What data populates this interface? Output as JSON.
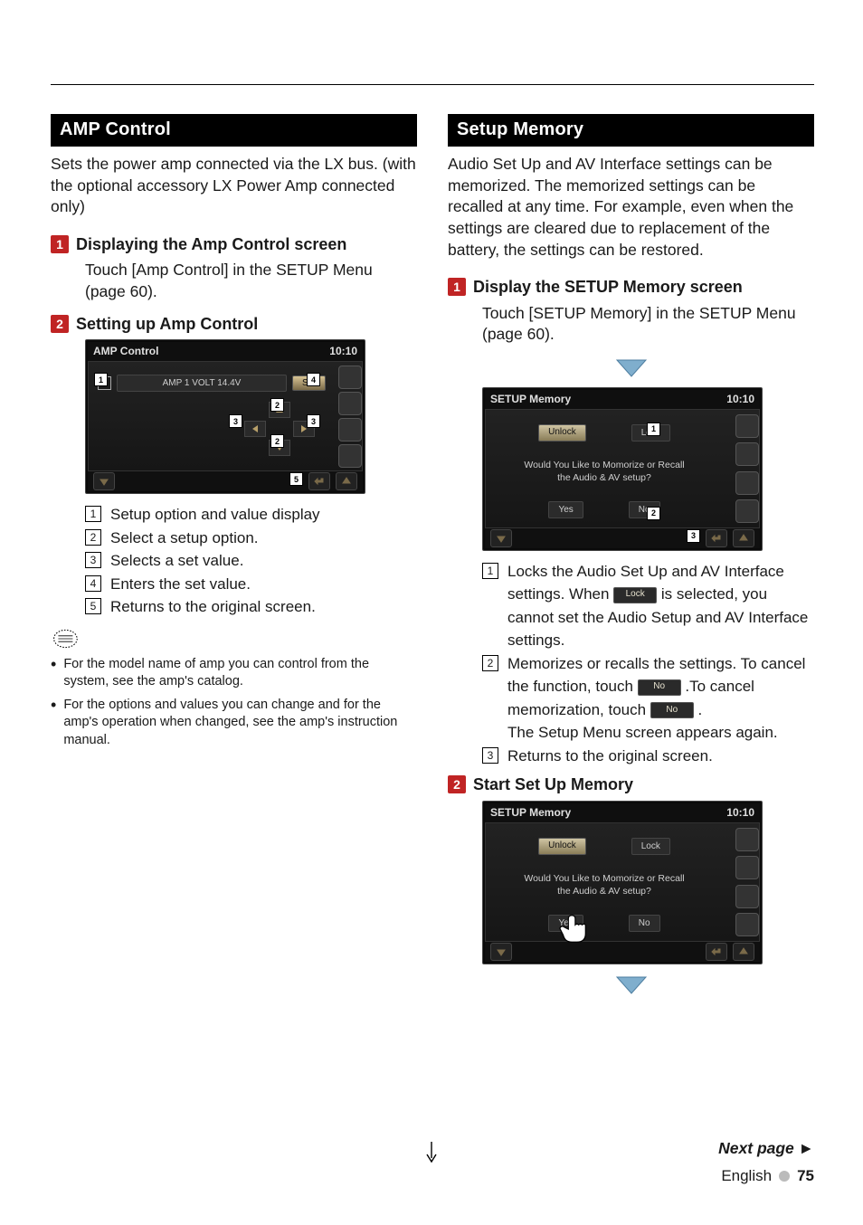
{
  "left": {
    "heading": "AMP Control",
    "lead": "Sets the power amp connected via the LX bus. (with the optional accessory LX Power Amp connected only)",
    "step1_title": "Displaying the Amp Control screen",
    "step1_body": "Touch [Amp Control] in the SETUP Menu (page 60).",
    "step2_title": "Setting up Amp Control",
    "shot": {
      "title": "AMP Control",
      "clock": "10:10",
      "value": "AMP 1 VOLT 14.4V",
      "set": "Set"
    },
    "legend": {
      "i1": "Setup option and value display",
      "i2": "Select a setup option.",
      "i3": "Selects a set value.",
      "i4": "Enters the set value.",
      "i5": "Returns to the original screen."
    },
    "note1": "For the model name of amp you can control from the system, see the amp's catalog.",
    "note2": "For the options and values you can change and for the amp's operation when changed, see the amp's instruction manual."
  },
  "right": {
    "heading": "Setup Memory",
    "lead": "Audio Set Up and AV Interface settings can be memorized. The memorized settings can be recalled at any time. For example, even when the settings are cleared due to replacement of the battery, the settings can be restored.",
    "step1_title": "Display the SETUP Memory screen",
    "step1_body": "Touch [SETUP Memory] in the SETUP Menu (page 60).",
    "shot": {
      "title": "SETUP Memory",
      "clock": "10:10",
      "unlock": "Unlock",
      "lock": "Lock",
      "msg1": "Would You Like to Momorize or Recall",
      "msg2": "the Audio & AV setup?",
      "yes": "Yes",
      "no": "No"
    },
    "legend": {
      "i1a": "Locks the Audio Set Up and AV Interface settings. When ",
      "i1_chip": "Lock",
      "i1b": " is selected, you cannot set the Audio Setup and AV Interface settings.",
      "i2a": "Memorizes or recalls the settings. To cancel the function, touch ",
      "i2_chip1": "No",
      "i2b": " .To cancel memorization, touch ",
      "i2_chip2": "No",
      "i2c": ".",
      "i2d": "The Setup Menu screen appears again.",
      "i3": "Returns to the original screen."
    },
    "step2_title": "Start Set Up Memory"
  },
  "footer": {
    "next": "Next page",
    "lang": "English",
    "page": "75"
  }
}
